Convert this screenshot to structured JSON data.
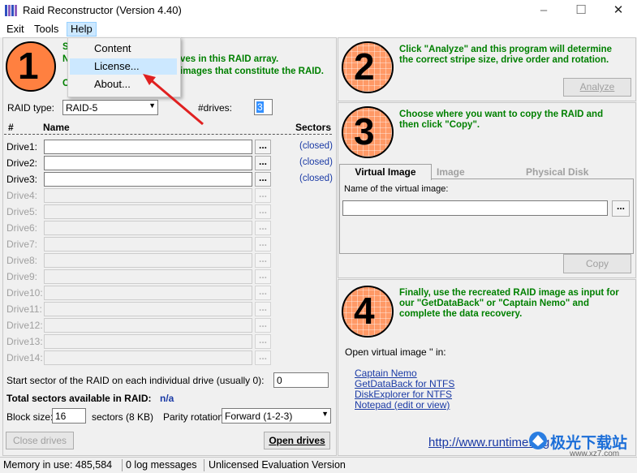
{
  "window": {
    "title": "Raid Reconstructor (Version 4.40)"
  },
  "menu": {
    "exit": "Exit",
    "tools": "Tools",
    "help": "Help"
  },
  "help_menu": {
    "content": "Content",
    "license": "License...",
    "about": "About..."
  },
  "step1": {
    "number": "1",
    "line1_visible": "S",
    "line1_tail": "ves in this RAID array.",
    "line2_visible": "N",
    "line2_tail": "images that constitute the RAID.",
    "line3_visible": "C",
    "raid_type_label": "RAID type:",
    "raid_type_value": "RAID-5",
    "drives_label": "#drives:",
    "drives_value": "3",
    "col_num": "#",
    "col_name": "Name",
    "col_sectors": "Sectors",
    "drives": [
      {
        "label": "Drive1:",
        "status": "(closed)"
      },
      {
        "label": "Drive2:",
        "status": "(closed)"
      },
      {
        "label": "Drive3:",
        "status": "(closed)"
      },
      {
        "label": "Drive4:",
        "status": ""
      },
      {
        "label": "Drive5:",
        "status": ""
      },
      {
        "label": "Drive6:",
        "status": ""
      },
      {
        "label": "Drive7:",
        "status": ""
      },
      {
        "label": "Drive8:",
        "status": ""
      },
      {
        "label": "Drive9:",
        "status": ""
      },
      {
        "label": "Drive10:",
        "status": ""
      },
      {
        "label": "Drive11:",
        "status": ""
      },
      {
        "label": "Drive12:",
        "status": ""
      },
      {
        "label": "Drive13:",
        "status": ""
      },
      {
        "label": "Drive14:",
        "status": ""
      }
    ],
    "browse_label": "...",
    "start_sector_label": "Start sector of the RAID on each individual drive (usually 0):",
    "start_sector_value": "0",
    "total_label": "Total sectors available in RAID:",
    "total_value": "n/a",
    "block_size_label": "Block size:",
    "block_size_value": "16",
    "block_unit": "sectors (8 KB)",
    "parity_label": "Parity rotation:",
    "parity_value": "Forward (1-2-3)",
    "close_drives": "Close drives",
    "open_drives": "Open drives"
  },
  "step2": {
    "number": "2",
    "text": "Click \"Analyze\" and this program will determine the correct stripe size, drive order and rotation.",
    "analyze_button": "Analyze"
  },
  "step3": {
    "number": "3",
    "text": "Choose where you want to copy the RAID and then click \"Copy\".",
    "tabs": [
      "Virtual Image",
      "Image",
      "Physical Disk"
    ],
    "name_label": "Name of the virtual image:",
    "name_value": "",
    "copy_button": "Copy"
  },
  "step4": {
    "number": "4",
    "text": "Finally, use the recreated RAID image as input for our \"GetDataBack\" or \"Captain Nemo\" and complete the data recovery.",
    "open_label": "Open virtual image '' in:",
    "links": [
      "Captain Nemo",
      "GetDataBack for NTFS",
      "DiskExplorer for NTFS",
      "Notepad (edit or view)"
    ],
    "url": "http://www.runtime.org"
  },
  "status": {
    "memory": "Memory in use: 485,584",
    "log": "0 log messages",
    "license": "Unlicensed Evaluation Version"
  },
  "watermark": {
    "text": "极光下载站",
    "url": "www.xz7.com"
  },
  "colors": {
    "circle_orange": "#ff8040",
    "circle_grid": "#ffffff",
    "step_text_green": "#008000",
    "link_blue": "#1a3aa5"
  }
}
